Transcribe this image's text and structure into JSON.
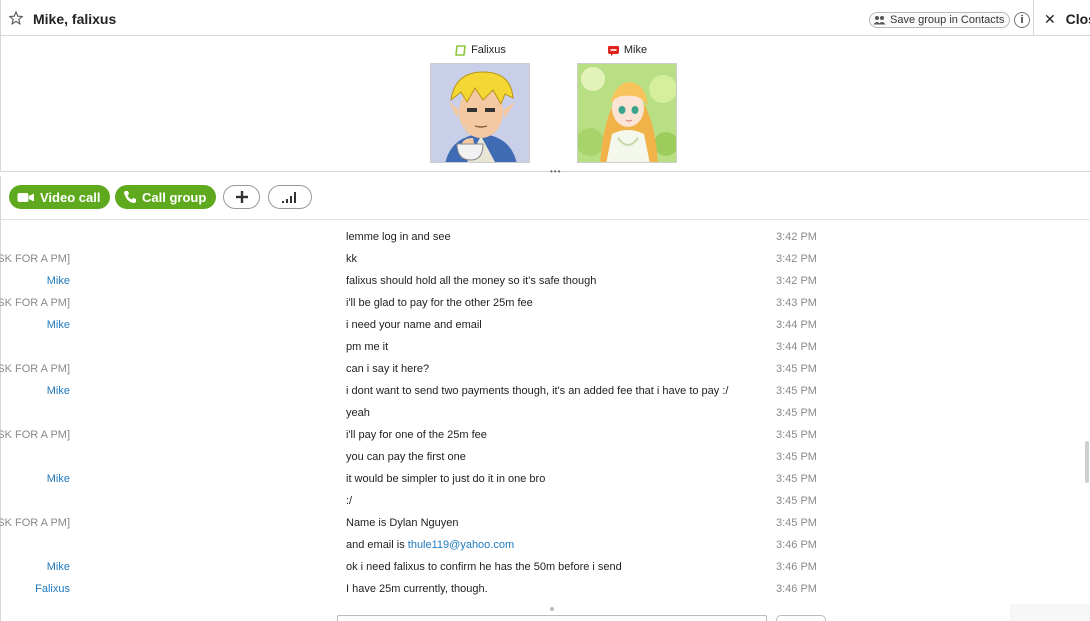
{
  "header": {
    "title": "Mike, falixus",
    "save_group_label": "Save group in Contacts",
    "info_label": "i",
    "close_label": "Close"
  },
  "participants": [
    {
      "name": "Falixus",
      "status": "online"
    },
    {
      "name": "Mike",
      "status": "busy"
    }
  ],
  "toolbar": {
    "video_call_label": "Video call",
    "call_group_label": "Call group",
    "add_label": "+",
    "signal_label": "call quality"
  },
  "messages": [
    {
      "sender": "",
      "sender_type": "",
      "text": "lemme log in and see",
      "time": "3:42 PM"
    },
    {
      "sender": "Thu Le [ASK FOR A PM]",
      "sender_type": "thu",
      "text": "kk",
      "time": "3:42 PM"
    },
    {
      "sender": "Mike",
      "sender_type": "mike",
      "text": "falixus should hold all the money so it's safe though",
      "time": "3:42 PM"
    },
    {
      "sender": "Thu Le [ASK FOR A PM]",
      "sender_type": "thu",
      "text": "i'll be glad to pay for the other 25m fee",
      "time": "3:43 PM"
    },
    {
      "sender": "Mike",
      "sender_type": "mike",
      "text": "i need your name and email",
      "time": "3:44 PM"
    },
    {
      "sender": "",
      "sender_type": "",
      "text": "pm me it",
      "time": "3:44 PM"
    },
    {
      "sender": "Thu Le [ASK FOR A PM]",
      "sender_type": "thu",
      "text": "can i say it here?",
      "time": "3:45 PM"
    },
    {
      "sender": "Mike",
      "sender_type": "mike",
      "text": "i dont want to send two payments though, it's an added fee that i have to pay :/",
      "time": "3:45 PM"
    },
    {
      "sender": "",
      "sender_type": "",
      "text": "yeah",
      "time": "3:45 PM"
    },
    {
      "sender": "Thu Le [ASK FOR A PM]",
      "sender_type": "thu",
      "text": "i'll pay for one of the 25m fee",
      "time": "3:45 PM"
    },
    {
      "sender": "",
      "sender_type": "",
      "text": "you can pay the first one",
      "time": "3:45 PM"
    },
    {
      "sender": "Mike",
      "sender_type": "mike",
      "text": "it would be simpler to just do it in one bro",
      "time": "3:45 PM"
    },
    {
      "sender": "",
      "sender_type": "",
      "text": ":/",
      "time": "3:45 PM"
    },
    {
      "sender": "Thu Le [ASK FOR A PM]",
      "sender_type": "thu",
      "text": "Name is Dylan Nguyen",
      "time": "3:45 PM"
    },
    {
      "sender": "",
      "sender_type": "",
      "text": "and email is ",
      "link": "thule119@yahoo.com",
      "time": "3:46 PM"
    },
    {
      "sender": "Mike",
      "sender_type": "mike",
      "text": "ok i need falixus to confirm he has the 50m before i send",
      "time": "3:46 PM"
    },
    {
      "sender": "Falixus",
      "sender_type": "falixus",
      "text": "I have 25m currently, though.",
      "time": "3:46 PM"
    }
  ],
  "colors": {
    "accent_green": "#5ea91e",
    "link_blue": "#1f7abf",
    "muted_gray": "#8a8a8a",
    "status_online": "#8cc63f",
    "status_busy": "#e2231a"
  },
  "icons": [
    "star-icon",
    "contacts-icon",
    "info-icon",
    "close-icon",
    "video-camera-icon",
    "phone-icon",
    "plus-icon",
    "signal-icon"
  ]
}
